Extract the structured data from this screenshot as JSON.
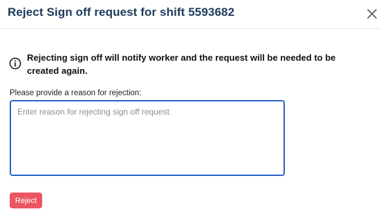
{
  "dialog": {
    "title": "Reject Sign off request for shift 5593682",
    "close_icon": "close-icon"
  },
  "notice": {
    "icon": "info-circle-icon",
    "text": "Rejecting sign off will notify worker and the request will be needed to be created again."
  },
  "form": {
    "label": "Please provide a reason for rejection:",
    "reason_value": "",
    "reason_placeholder": "Enter reason for rejecting sign off request"
  },
  "actions": {
    "reject_label": "Reject"
  },
  "colors": {
    "title": "#1d3a5a",
    "input_focus_border": "#2563c9",
    "reject_button": "#ec5663"
  }
}
